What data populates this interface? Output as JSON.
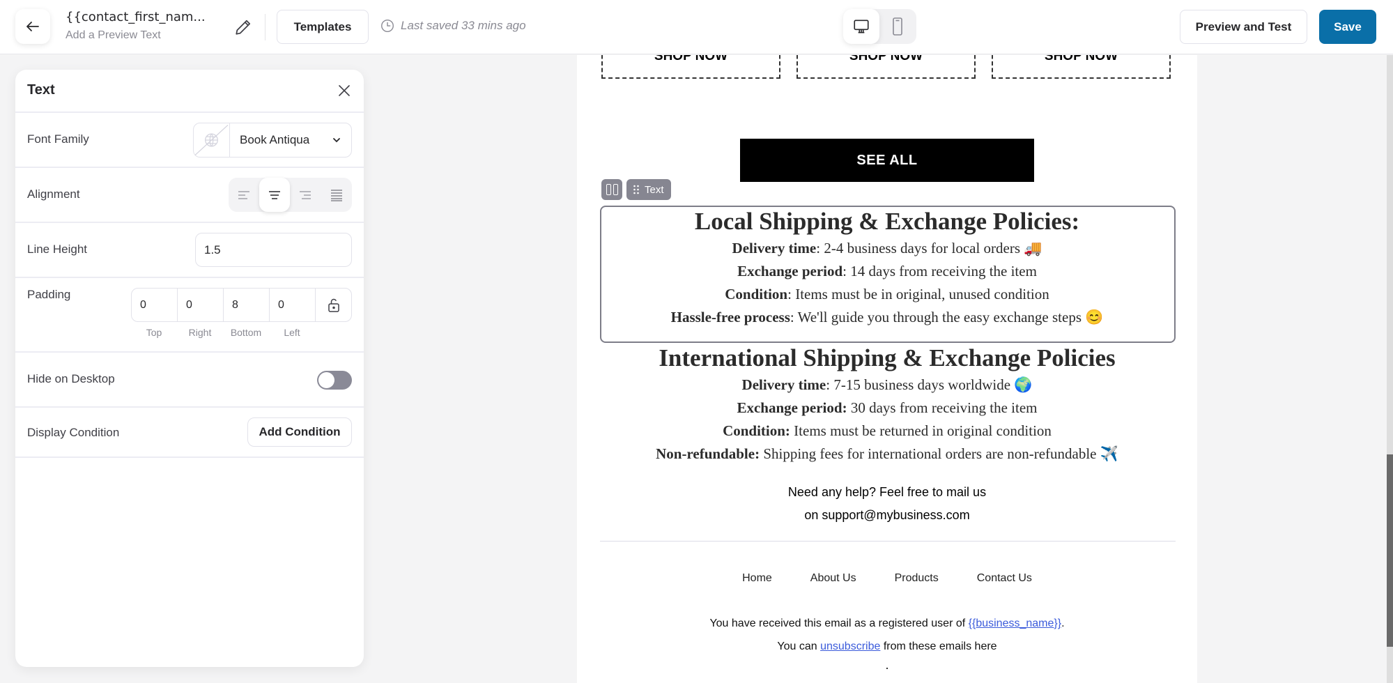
{
  "header": {
    "title": "{{contact_first_nam...",
    "subtitle": "Add a Preview Text",
    "templates_label": "Templates",
    "last_saved": "Last saved 33 mins ago",
    "device_modes": [
      "desktop",
      "mobile"
    ],
    "active_device": "desktop",
    "preview_label": "Preview and Test",
    "save_label": "Save",
    "save_color": "#0a6fa8"
  },
  "panel": {
    "title": "Text",
    "font_family": {
      "label": "Font Family",
      "value": "Book Antiqua"
    },
    "alignment": {
      "label": "Alignment",
      "options": [
        "left",
        "center",
        "right",
        "justify"
      ],
      "selected": "center"
    },
    "line_height": {
      "label": "Line Height",
      "value": "1.5"
    },
    "padding": {
      "label": "Padding",
      "values": [
        "0",
        "0",
        "8",
        "0"
      ],
      "sides": [
        "Top",
        "Right",
        "Bottom",
        "Left"
      ],
      "locked": false
    },
    "hide_on_desktop": {
      "label": "Hide on Desktop",
      "enabled": false
    },
    "display_condition": {
      "label": "Display Condition",
      "button": "Add Condition"
    }
  },
  "email": {
    "shop_buttons": [
      "SHOP NOW",
      "SHOP NOW",
      "SHOP NOW"
    ],
    "see_all": "SEE ALL",
    "selected_block_label": "Text",
    "local": {
      "heading": "Local Shipping & Exchange Policies:",
      "lines": [
        {
          "label": "Delivery time",
          "sep": ": ",
          "text": "2-4 business days for local orders 🚚"
        },
        {
          "label": "Exchange period",
          "sep": ": ",
          "text": "14 days from receiving the item"
        },
        {
          "label": "Condition",
          "sep": ": ",
          "text": "Items must be in original, unused condition"
        },
        {
          "label": "Hassle-free process",
          "sep": ": ",
          "text": "We'll guide you through the easy exchange steps 😊"
        }
      ]
    },
    "international": {
      "heading": "International Shipping & Exchange Policies",
      "lines": [
        {
          "label": "Delivery time",
          "sep": ": ",
          "text": "7-15 business days worldwide 🌍"
        },
        {
          "label": "Exchange period:",
          "sep": " ",
          "text": "30 days from receiving the item"
        },
        {
          "label": "Condition:",
          "sep": " ",
          "text": "Items must be returned in original condition"
        },
        {
          "label": "Non-refundable:",
          "sep": " ",
          "text": "Shipping fees for international orders are non-refundable ✈️"
        }
      ]
    },
    "help": [
      "Need any help? Feel free to mail us",
      "on support@mybusiness.com"
    ],
    "footer_nav": [
      "Home",
      "About Us",
      "Products",
      "Contact Us"
    ],
    "legal": {
      "line1_prefix": "You have received this email as a registered user of ",
      "business_link": "{{business_name}}",
      "line1_suffix": ".",
      "line2_prefix": "You can ",
      "unsubscribe_link": "unsubscribe",
      "line2_suffix": " from these emails here"
    }
  }
}
